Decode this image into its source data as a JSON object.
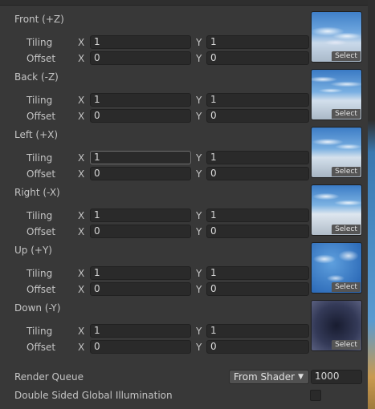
{
  "faces": [
    {
      "title": "Front (+Z)",
      "tiling_label": "Tiling",
      "offset_label": "Offset",
      "tiling_x": "1",
      "tiling_y": "1",
      "offset_x": "0",
      "offset_y": "0",
      "select_label": "Select"
    },
    {
      "title": "Back (-Z)",
      "tiling_label": "Tiling",
      "offset_label": "Offset",
      "tiling_x": "1",
      "tiling_y": "1",
      "offset_x": "0",
      "offset_y": "0",
      "select_label": "Select"
    },
    {
      "title": "Left (+X)",
      "tiling_label": "Tiling",
      "offset_label": "Offset",
      "tiling_x": "1",
      "tiling_y": "1",
      "offset_x": "0",
      "offset_y": "0",
      "select_label": "Select"
    },
    {
      "title": "Right (-X)",
      "tiling_label": "Tiling",
      "offset_label": "Offset",
      "tiling_x": "1",
      "tiling_y": "1",
      "offset_x": "0",
      "offset_y": "0",
      "select_label": "Select"
    },
    {
      "title": "Up (+Y)",
      "tiling_label": "Tiling",
      "offset_label": "Offset",
      "tiling_x": "1",
      "tiling_y": "1",
      "offset_x": "0",
      "offset_y": "0",
      "select_label": "Select"
    },
    {
      "title": "Down (-Y)",
      "tiling_label": "Tiling",
      "offset_label": "Offset",
      "tiling_x": "1",
      "tiling_y": "1",
      "offset_x": "0",
      "offset_y": "0",
      "select_label": "Select"
    }
  ],
  "axis_labels": {
    "x": "X",
    "y": "Y"
  },
  "render_queue": {
    "label": "Render Queue",
    "mode": "From Shader",
    "value": "1000"
  },
  "global_illumination": {
    "label": "Double Sided Global Illumination",
    "checked": false
  },
  "colors": {
    "panel_bg": "#383838",
    "field_bg": "#2a2a2a",
    "text": "#c4c4c4"
  }
}
